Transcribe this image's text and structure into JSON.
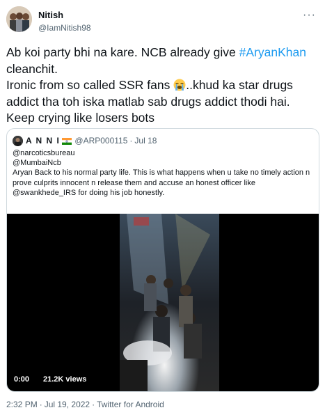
{
  "author": {
    "display_name": "Nitish",
    "handle": "@IamNitish98"
  },
  "more_icon": "ellipsis-icon",
  "tweet": {
    "line1_before": "Ab koi party bhi na kare. NCB already give ",
    "hashtag": "#AryanKhan",
    "line1_after": " cleanchit.\nIronic from so called SSR fans ",
    "emoji_icon": "loudly-crying-face-icon",
    "line2_after": "..khud ka star drugs addict tha toh iska matlab sab drugs addict thodi hai.\nKeep crying like losers bots"
  },
  "quote": {
    "display_name": "A N N I",
    "flag_icon": "india-flag-icon",
    "handle": "@ARP000115",
    "separator": "·",
    "date": "Jul 18",
    "text": "@narcoticsbureau\n@MumbaiNcb\nAryan Back to his normal party life. This is what happens when u take no timely action n prove culprits innocent n release them and accuse an honest officer like @swankhede_IRS for doing his job honestly.",
    "video": {
      "time": "0:00",
      "views": "21.2K views"
    }
  },
  "footer": {
    "time": "2:32 PM",
    "separator": "·",
    "date": "Jul 19, 2022",
    "source": "Twitter for Android"
  },
  "colors": {
    "link": "#1d9bf0",
    "secondary_text": "#536471",
    "border": "#cfd9de"
  }
}
